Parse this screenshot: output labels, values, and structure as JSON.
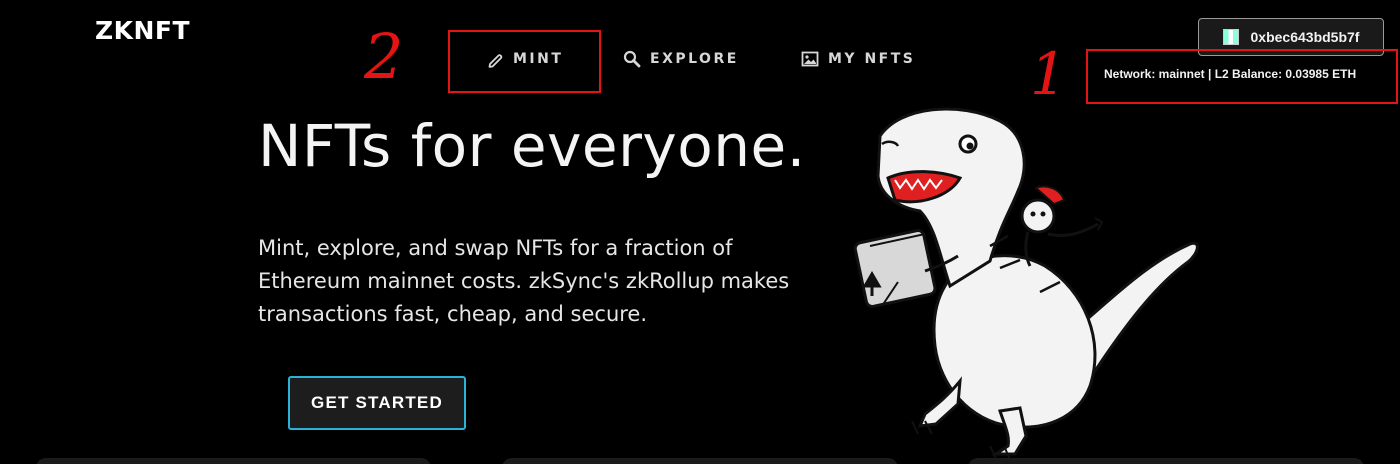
{
  "header": {
    "logo": "ZKNFT",
    "nav": {
      "mint": "MINT",
      "explore": "EXPLORE",
      "my_nfts": "MY NFTS"
    },
    "wallet": {
      "address": "0xbec643bd5b7f"
    },
    "network_info": "Network: mainnet | L2 Balance: 0.03985 ETH"
  },
  "annotations": {
    "one": "1",
    "two": "2"
  },
  "hero": {
    "title": "NFTs for everyone.",
    "description": "Mint, explore, and swap NFTs for a fraction of Ethereum mainnet costs. zkSync's zkRollup makes transactions fast, cheap, and secure.",
    "cta": "GET STARTED"
  },
  "colors": {
    "background": "#000000",
    "cta_border": "#2ab3d6",
    "annotation": "#e41414"
  },
  "icons": [
    "pen-icon",
    "search-icon",
    "gallery-icon",
    "wallet-avatar-icon"
  ]
}
